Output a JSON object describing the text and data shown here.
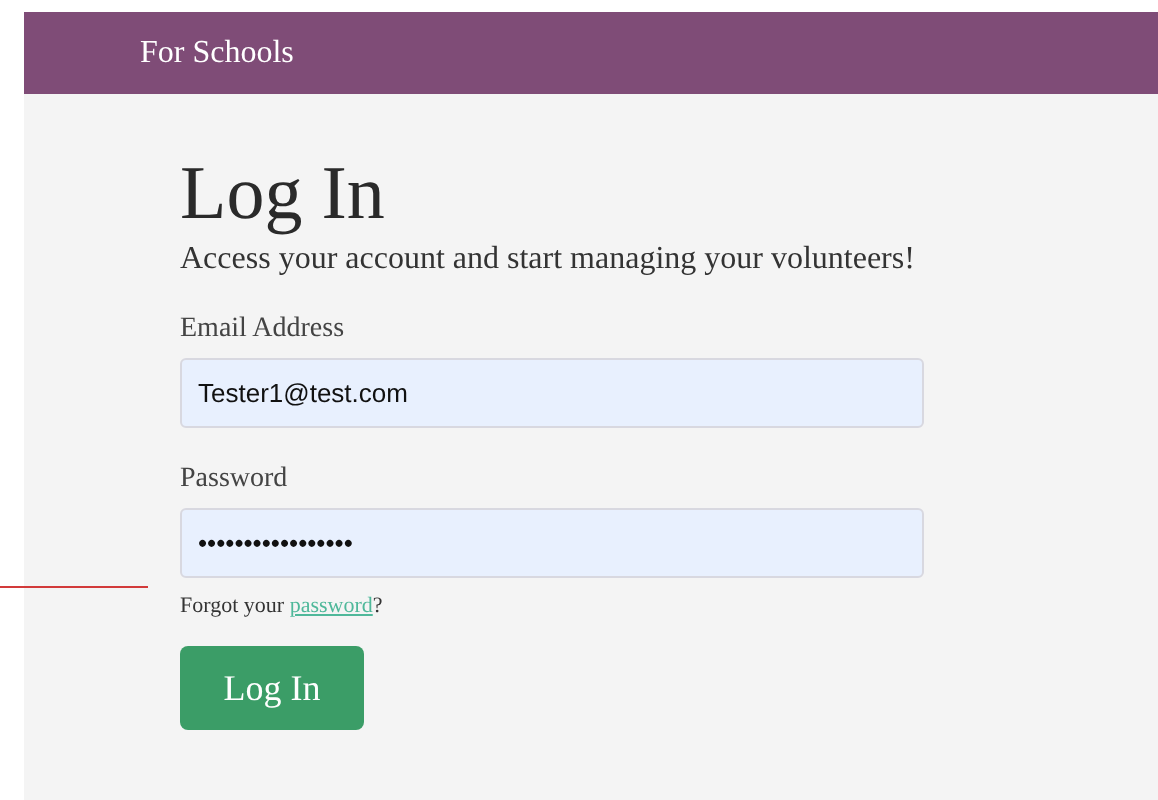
{
  "header": {
    "title": "For Schools"
  },
  "login": {
    "heading": "Log In",
    "subtitle": "Access your account and start managing your volunteers!",
    "fields": [
      {
        "label": "Email Address",
        "value": "Tester1@test.com"
      },
      {
        "label": "Password",
        "value": "•••••••••••••••••"
      }
    ],
    "forgot": {
      "before": "Forgot your ",
      "link": "password",
      "after": "?"
    },
    "button": "Log In"
  }
}
